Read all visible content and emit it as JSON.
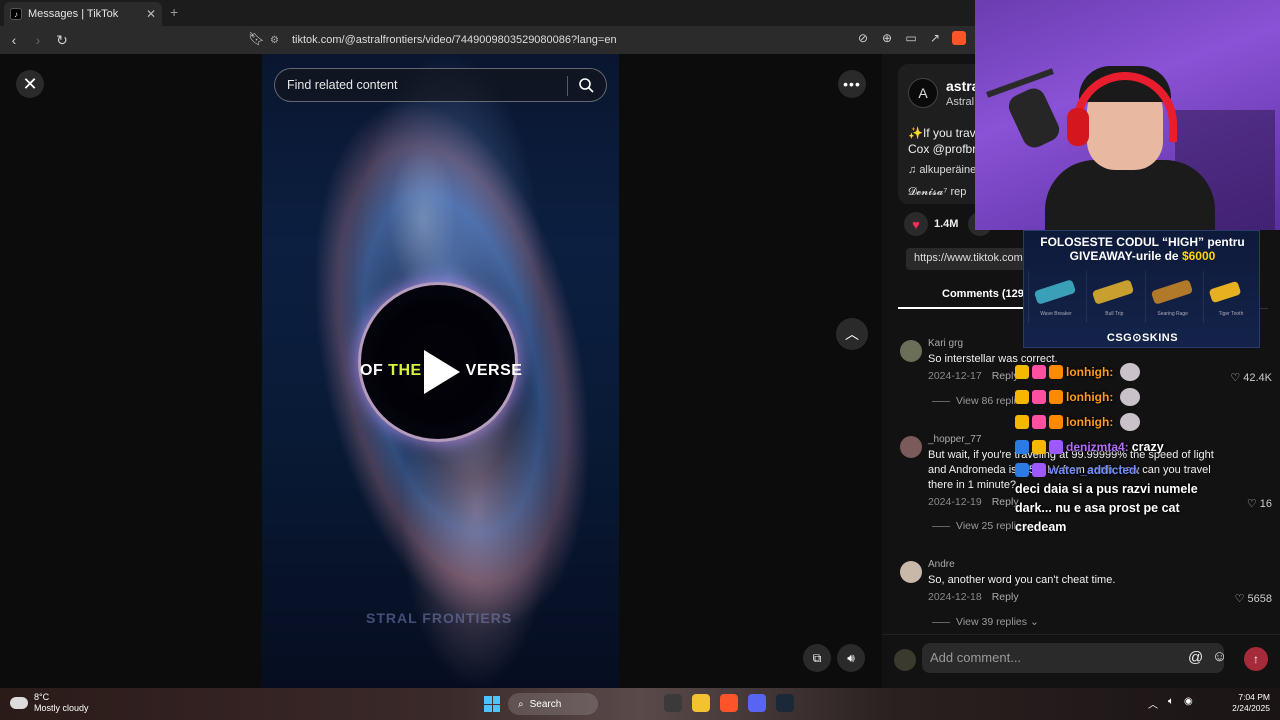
{
  "browser": {
    "tab_title": "Messages | TikTok",
    "new_tab_symbol": "+",
    "url": "tiktok.com/@astralfrontiers/video/7449009803529080086?lang=en"
  },
  "video": {
    "search_placeholder": "Find related content",
    "overlay_prefix": "OF ",
    "overlay_highlight": "THE",
    "overlay_suffix": "VERSE",
    "watermark": "STRAL FRONTIERS"
  },
  "post": {
    "account_name": "astra",
    "account_sub": "Astral",
    "description_line1": "✨If you trav",
    "description_line2": "Cox @profbr",
    "music": "alkuperäine",
    "repost": "𝓓𝓮𝓷𝓲𝓼𝓪⁷ rep",
    "likes": "1.4M",
    "link": "https://www.tiktok.com",
    "comments_tab": "Comments (129"
  },
  "comments": [
    {
      "user": "Kari grg",
      "text": "So interstellar was correct.",
      "date": "2024-12-17",
      "reply": "Reply",
      "likes": "42.4K",
      "view_replies": "View 86 replies"
    },
    {
      "user": "_hopper_77",
      "text": "But wait, if you're traveling at 99.99999% the speed of light and Andromeda is 2.5M LY from earth, how can you travel there in 1 minute?",
      "date": "2024-12-19",
      "reply": "Reply",
      "likes": "16",
      "view_replies": "View 25 replies"
    },
    {
      "user": "Andre",
      "text": "So, another word you can't cheat time.",
      "date": "2024-12-18",
      "reply": "Reply",
      "likes": "5658",
      "view_replies": "View 39 replies"
    }
  ],
  "add_comment": {
    "placeholder": "Add comment..."
  },
  "stream": {
    "promo_line1": "FOLOSESTE CODUL “HIGH” pentru",
    "promo_line2_prefix": "GIVEAWAY-urile de ",
    "promo_amount": "$6000",
    "promo_logo": "CSG⊙SKINS",
    "skins": [
      "Wave Breaker",
      "Bull Trip",
      "Searing Rage",
      "Tiger Tooth"
    ],
    "chat": [
      {
        "name": "lonhigh:",
        "color": "orange"
      },
      {
        "name": "lonhigh:",
        "color": "orange"
      },
      {
        "name": "lonhigh:",
        "color": "orange"
      },
      {
        "name": "denizmta4:",
        "message": "crazy",
        "color": "purple"
      },
      {
        "name": "water_addicted:",
        "message": "deci daia si a pus razvi numele dark... nu e asa prost pe cat credeam",
        "color": "blue"
      }
    ]
  },
  "taskbar": {
    "temperature": "8°C",
    "weather": "Mostly cloudy",
    "search_label": "Search",
    "time": "7:04 PM",
    "date": "2/24/2025"
  }
}
